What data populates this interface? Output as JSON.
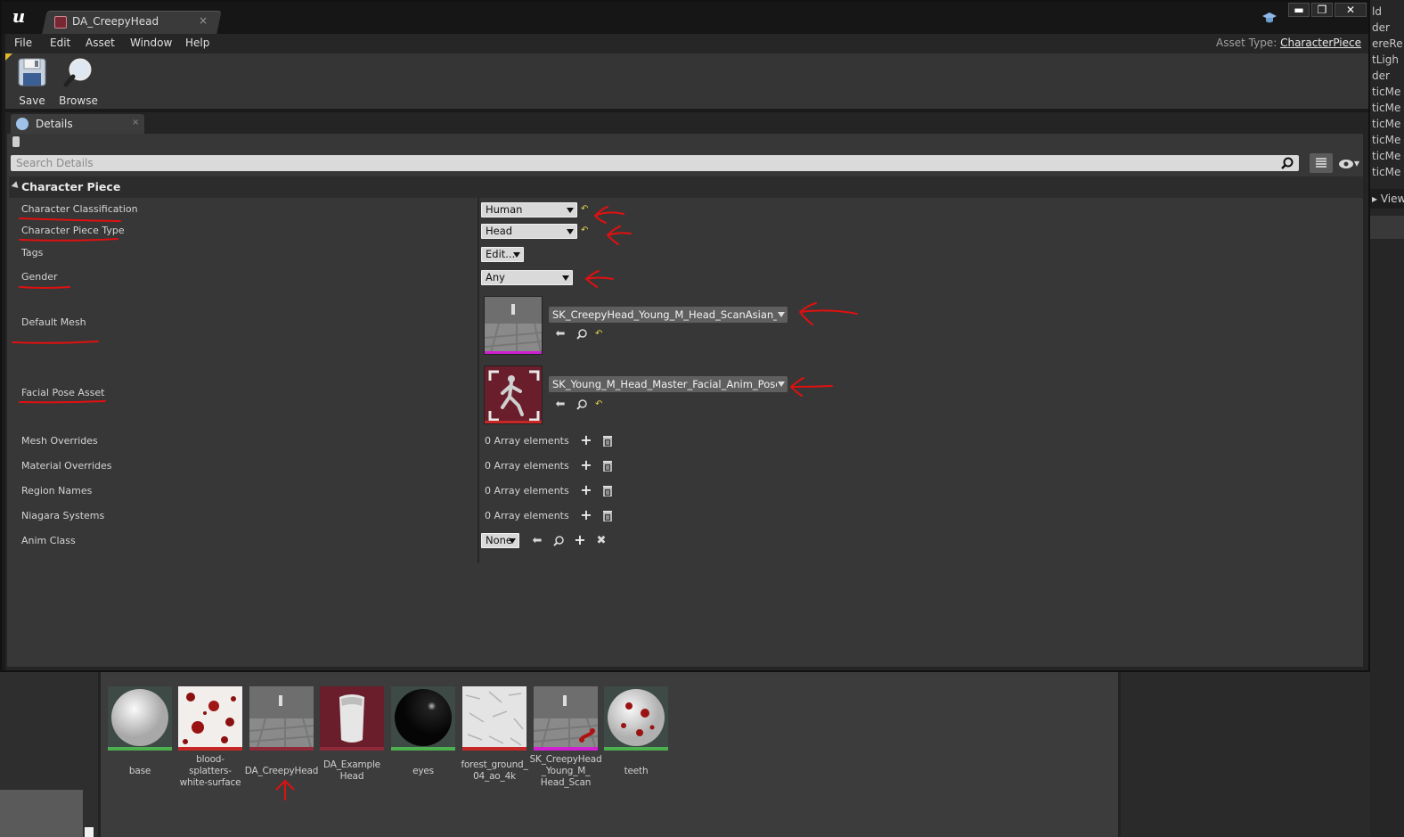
{
  "window": {
    "tab_title": "DA_CreepyHead",
    "tab_close": "×",
    "win_minimize": "▬",
    "win_maximize": "❐",
    "win_close": "✕"
  },
  "menu": {
    "items": [
      "File",
      "Edit",
      "Asset",
      "Window",
      "Help"
    ],
    "asset_type_label": "Asset Type:",
    "asset_type_value": "CharacterPiece"
  },
  "toolbar": {
    "save_label": "Save",
    "browse_label": "Browse"
  },
  "details": {
    "tab_label": "Details",
    "tab_close": "×",
    "search_placeholder": "Search Details",
    "eye_caret": "▾",
    "category_label": "Character Piece",
    "properties": {
      "character_classification": {
        "label": "Character Classification",
        "value": "Human"
      },
      "character_piece_type": {
        "label": "Character Piece Type",
        "value": "Head"
      },
      "tags": {
        "label": "Tags",
        "value": "Edit..."
      },
      "gender": {
        "label": "Gender",
        "value": "Any"
      },
      "default_mesh": {
        "label": "Default Mesh",
        "value": "SK_CreepyHead_Young_M_Head_ScanAsian_Master"
      },
      "facial_pose_asset": {
        "label": "Facial Pose Asset",
        "value": "SK_Young_M_Head_Master_Facial_Anim_PoseAsset"
      },
      "mesh_overrides": {
        "label": "Mesh Overrides",
        "value": "0 Array elements"
      },
      "material_overrides": {
        "label": "Material Overrides",
        "value": "0 Array elements"
      },
      "region_names": {
        "label": "Region Names",
        "value": "0 Array elements"
      },
      "niagara_systems": {
        "label": "Niagara Systems",
        "value": "0 Array elements"
      },
      "anim_class": {
        "label": "Anim Class",
        "value": "None"
      }
    }
  },
  "content_browser": {
    "assets": [
      {
        "label": "base",
        "bar_color": "#4caf50"
      },
      {
        "label": "blood-splatters-white-surface",
        "bar_color": "#c62828"
      },
      {
        "label": "DA_CreepyHead",
        "bar_color": "#8e2a3a"
      },
      {
        "label": "DA_Example Head",
        "bar_color": "#8e2a3a"
      },
      {
        "label": "eyes",
        "bar_color": "#4caf50"
      },
      {
        "label": "forest_ground_ 04_ao_4k",
        "bar_color": "#c62828"
      },
      {
        "label": "SK_CreepyHead _Young_M_ Head_Scan",
        "bar_color": "#d020d0"
      },
      {
        "label": "teeth",
        "bar_color": "#4caf50"
      }
    ]
  },
  "background_panel": {
    "items": [
      "ld",
      "der",
      "ereRe",
      "tLigh",
      "der",
      "ticMe",
      "ticMe",
      "ticMe",
      "ticMe",
      "ticMe",
      "ticMe"
    ],
    "view_label": "▸ View"
  },
  "colors": {
    "annotation_red": "#e01010",
    "reset_yellow": "#e0d24a",
    "asset_red": "#8e2a3a"
  }
}
